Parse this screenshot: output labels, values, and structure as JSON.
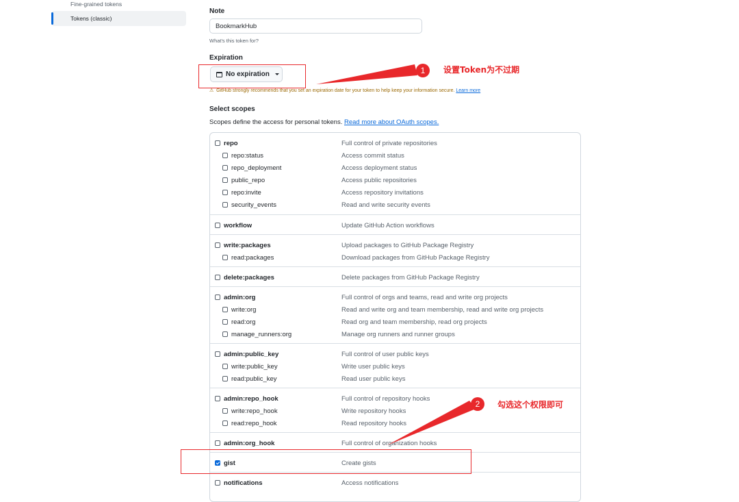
{
  "sidebar": {
    "items": [
      {
        "label": "Fine-grained tokens",
        "active": false
      },
      {
        "label": "Tokens (classic)",
        "active": true
      }
    ]
  },
  "note": {
    "label": "Note",
    "value": "BookmarkHub",
    "hint": "What's this token for?"
  },
  "expiration": {
    "label": "Expiration",
    "selected": "No expiration",
    "warning": "GitHub strongly recommends that you set an expiration date for your token to help keep your information secure.",
    "learn_more": "Learn more"
  },
  "scopes": {
    "label": "Select scopes",
    "description": "Scopes define the access for personal tokens.",
    "link": "Read more about OAuth scopes.",
    "groups": [
      {
        "items": [
          {
            "name": "repo",
            "desc": "Full control of private repositories",
            "checked": false
          },
          {
            "name": "repo:status",
            "desc": "Access commit status",
            "checked": false
          },
          {
            "name": "repo_deployment",
            "desc": "Access deployment status",
            "checked": false
          },
          {
            "name": "public_repo",
            "desc": "Access public repositories",
            "checked": false
          },
          {
            "name": "repo:invite",
            "desc": "Access repository invitations",
            "checked": false
          },
          {
            "name": "security_events",
            "desc": "Read and write security events",
            "checked": false
          }
        ]
      },
      {
        "items": [
          {
            "name": "workflow",
            "desc": "Update GitHub Action workflows",
            "checked": false
          }
        ]
      },
      {
        "items": [
          {
            "name": "write:packages",
            "desc": "Upload packages to GitHub Package Registry",
            "checked": false
          },
          {
            "name": "read:packages",
            "desc": "Download packages from GitHub Package Registry",
            "checked": false
          }
        ]
      },
      {
        "items": [
          {
            "name": "delete:packages",
            "desc": "Delete packages from GitHub Package Registry",
            "checked": false
          }
        ]
      },
      {
        "items": [
          {
            "name": "admin:org",
            "desc": "Full control of orgs and teams, read and write org projects",
            "checked": false
          },
          {
            "name": "write:org",
            "desc": "Read and write org and team membership, read and write org projects",
            "checked": false
          },
          {
            "name": "read:org",
            "desc": "Read org and team membership, read org projects",
            "checked": false
          },
          {
            "name": "manage_runners:org",
            "desc": "Manage org runners and runner groups",
            "checked": false
          }
        ]
      },
      {
        "items": [
          {
            "name": "admin:public_key",
            "desc": "Full control of user public keys",
            "checked": false
          },
          {
            "name": "write:public_key",
            "desc": "Write user public keys",
            "checked": false
          },
          {
            "name": "read:public_key",
            "desc": "Read user public keys",
            "checked": false
          }
        ]
      },
      {
        "items": [
          {
            "name": "admin:repo_hook",
            "desc": "Full control of repository hooks",
            "checked": false
          },
          {
            "name": "write:repo_hook",
            "desc": "Write repository hooks",
            "checked": false
          },
          {
            "name": "read:repo_hook",
            "desc": "Read repository hooks",
            "checked": false
          }
        ]
      },
      {
        "items": [
          {
            "name": "admin:org_hook",
            "desc": "Full control of organization hooks",
            "checked": false
          }
        ]
      },
      {
        "items": [
          {
            "name": "gist",
            "desc": "Create gists",
            "checked": true
          }
        ]
      },
      {
        "items": [
          {
            "name": "notifications",
            "desc": "Access notifications",
            "checked": false
          }
        ]
      }
    ]
  },
  "annotations": {
    "step1_number": "1",
    "step1_text": "设置Token为不过期",
    "step2_number": "2",
    "step2_text": "勾选这个权限即可",
    "color": "#e8282b"
  },
  "colors": {
    "accent": "#0969da",
    "warning": "#9a6700"
  }
}
